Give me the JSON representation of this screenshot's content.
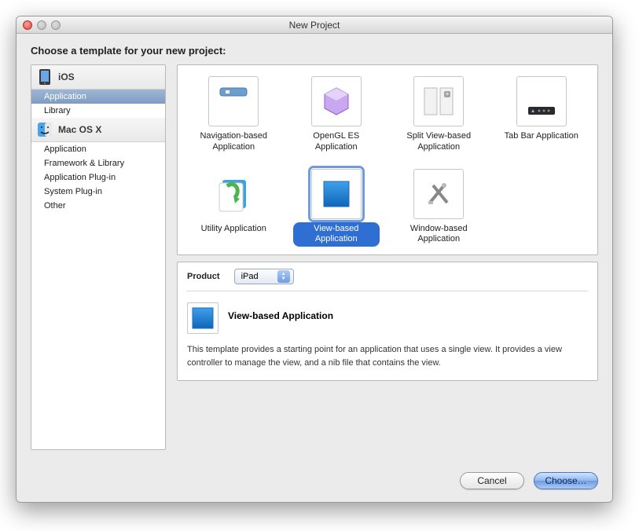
{
  "window": {
    "title": "New Project"
  },
  "heading": "Choose a template for your new project:",
  "sidebar": {
    "groups": [
      {
        "title": "iOS",
        "icon": "iphone-icon",
        "items": [
          {
            "label": "Application",
            "selected": true
          },
          {
            "label": "Library",
            "selected": false
          }
        ]
      },
      {
        "title": "Mac OS X",
        "icon": "finder-icon",
        "items": [
          {
            "label": "Application",
            "selected": false
          },
          {
            "label": "Framework & Library",
            "selected": false
          },
          {
            "label": "Application Plug-in",
            "selected": false
          },
          {
            "label": "System Plug-in",
            "selected": false
          },
          {
            "label": "Other",
            "selected": false
          }
        ]
      }
    ]
  },
  "templates": [
    {
      "label": "Navigation-based Application",
      "icon": "nav-app-icon",
      "selected": false
    },
    {
      "label": "OpenGL ES Application",
      "icon": "opengl-icon",
      "selected": false
    },
    {
      "label": "Split View-based Application",
      "icon": "splitview-icon",
      "selected": false
    },
    {
      "label": "Tab Bar Application",
      "icon": "tabbar-icon",
      "selected": false
    },
    {
      "label": "Utility Application",
      "icon": "utility-icon",
      "selected": false
    },
    {
      "label": "View-based Application",
      "icon": "view-icon",
      "selected": true
    },
    {
      "label": "Window-based Application",
      "icon": "window-icon",
      "selected": false
    }
  ],
  "product": {
    "label": "Product",
    "value": "iPad"
  },
  "detail": {
    "title": "View-based Application",
    "description": "This template provides a starting point for an application that uses a single view. It provides a view controller to manage the view, and a nib file that contains the view."
  },
  "buttons": {
    "cancel": "Cancel",
    "choose": "Choose…"
  }
}
